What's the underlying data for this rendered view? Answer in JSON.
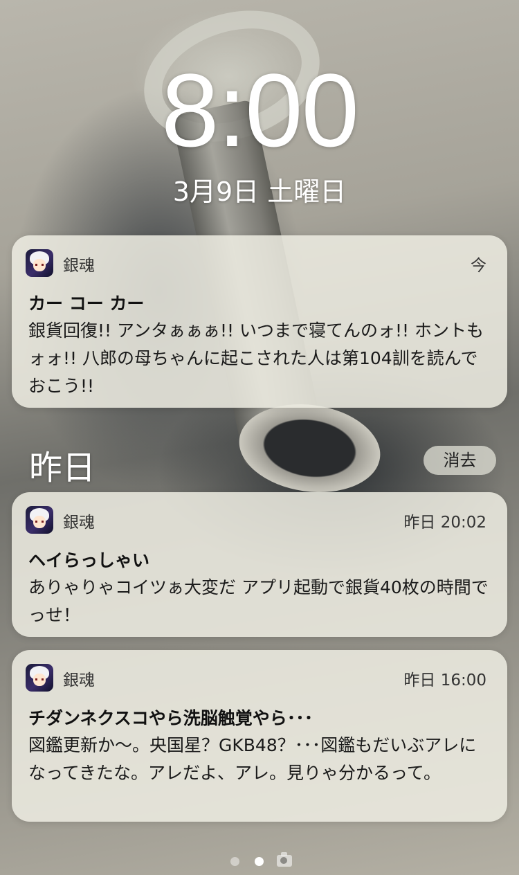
{
  "lockscreen": {
    "time": "8:00",
    "date": "3月9日 土曜日"
  },
  "notifications": [
    {
      "app": "銀魂",
      "time": "今",
      "title": "カー コー カー",
      "body": "銀貨回復!! アンタぁぁぁ!! いつまで寝てんのォ!! ホントもォォ!! 八郎の母ちゃんに起こされた人は第104訓を読んでおこう!!"
    }
  ],
  "yesterday": {
    "heading": "昨日",
    "clear_label": "消去",
    "notifications": [
      {
        "app": "銀魂",
        "time": "昨日 20:02",
        "title": "ヘイらっしゃい",
        "body": "ありゃりゃコイツぁ大変だ アプリ起動で銀貨40枚の時間でっせ！"
      },
      {
        "app": "銀魂",
        "time": "昨日 16:00",
        "title": "チダンネクスコやら洗脳触覚やら･･･",
        "body": "図鑑更新か〜。央国星？GKB48？･･･図鑑もだいぶアレになってきたな。アレだよ、アレ。見りゃ分かるって。"
      }
    ]
  },
  "icons": {
    "app_icon": "gintama-app-icon",
    "camera": "camera-icon"
  }
}
